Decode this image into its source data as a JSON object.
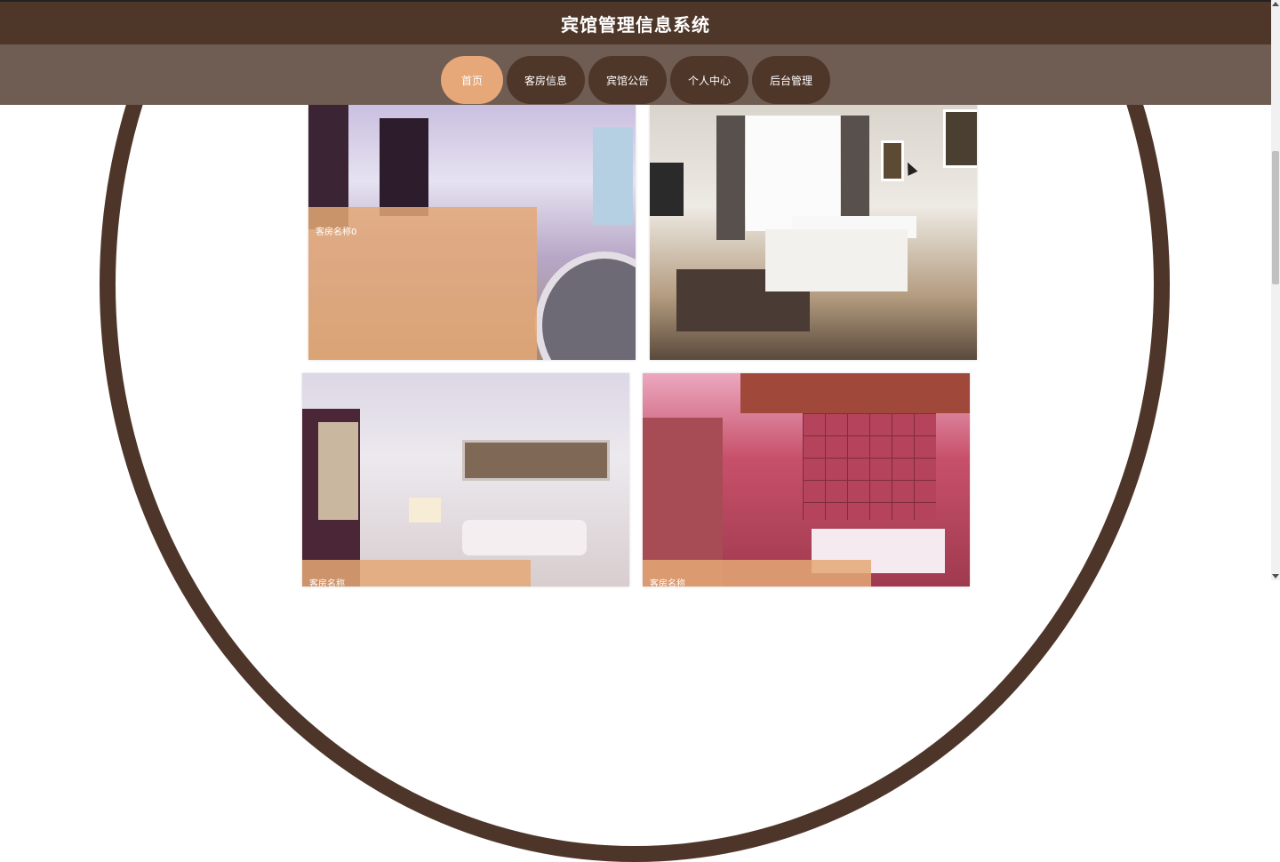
{
  "header": {
    "title": "宾馆管理信息系统"
  },
  "nav": {
    "items": [
      {
        "label": "首页",
        "active": true
      },
      {
        "label": "客房信息",
        "active": false
      },
      {
        "label": "宾馆公告",
        "active": false
      },
      {
        "label": "个人中心",
        "active": false
      },
      {
        "label": "后台管理",
        "active": false
      }
    ]
  },
  "rooms": [
    {
      "name": "客房名称0"
    },
    {
      "name": ""
    },
    {
      "name": "客房名称"
    },
    {
      "name": "客房名称"
    }
  ],
  "colors": {
    "header_bg": "#4e3628",
    "nav_bg": "#6f5c53",
    "nav_active": "#e6a878",
    "overlay": "#e4a876"
  },
  "icons": {
    "cursor": "mouse-pointer-icon"
  }
}
